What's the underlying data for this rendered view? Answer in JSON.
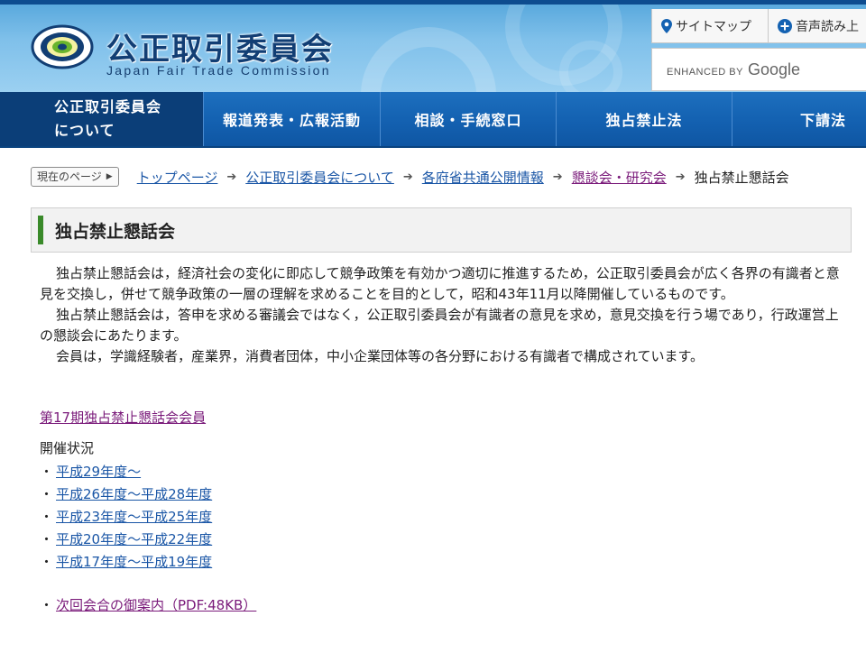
{
  "header": {
    "logo_title": "公正取引委員会",
    "logo_subtitle": "Japan Fair Trade Commission",
    "sitemap_label": "サイトマップ",
    "voice_label": "音声読み上",
    "search": {
      "enhanced_by": "ENHANCED BY",
      "brand": "Google",
      "value": ""
    }
  },
  "nav": {
    "items": [
      {
        "line1": "公正取引委員会",
        "line2": "について",
        "active": true
      },
      {
        "label": "報道発表・広報活動"
      },
      {
        "label": "相談・手続窓口"
      },
      {
        "label": "独占禁止法"
      },
      {
        "label": "下請法"
      }
    ]
  },
  "breadcrumb": {
    "label": "現在のページ",
    "links": [
      "トップページ",
      "公正取引委員会について",
      "各府省共通公開情報",
      "懇談会・研究会"
    ],
    "current": "独占禁止懇話会"
  },
  "page": {
    "title": "独占禁止懇話会",
    "paragraphs": [
      "独占禁止懇話会は，経済社会の変化に即応して競争政策を有効かつ適切に推進するため，公正取引委員会が広く各界の有識者と意見を交換し，併せて競争政策の一層の理解を求めることを目的として，昭和43年11月以降開催しているものです。",
      "独占禁止懇話会は，答申を求める審議会ではなく，公正取引委員会が有識者の意見を求め，意見交換を行う場であり，行政運営上の懇談会にあたります。",
      "会員は，学識経験者，産業界，消費者団体，中小企業団体等の各分野における有識者で構成されています。"
    ],
    "member_link": "第17期独占禁止懇話会会員",
    "status_heading": "開催状況",
    "bullet": "・",
    "status_links": [
      "平成29年度～",
      "平成26年度～平成28年度",
      "平成23年度～平成25年度",
      "平成20年度～平成22年度",
      "平成17年度～平成19年度"
    ],
    "next_meeting": "次回会合の御案内（PDF:48KB）"
  },
  "colors": {
    "header_top": "#0d4c8f",
    "nav_blue": "#1462b2",
    "nav_active": "#0b3e78",
    "link": "#1a56a6",
    "visited": "#7a1a7a",
    "title_accent": "#3a8a2a"
  }
}
